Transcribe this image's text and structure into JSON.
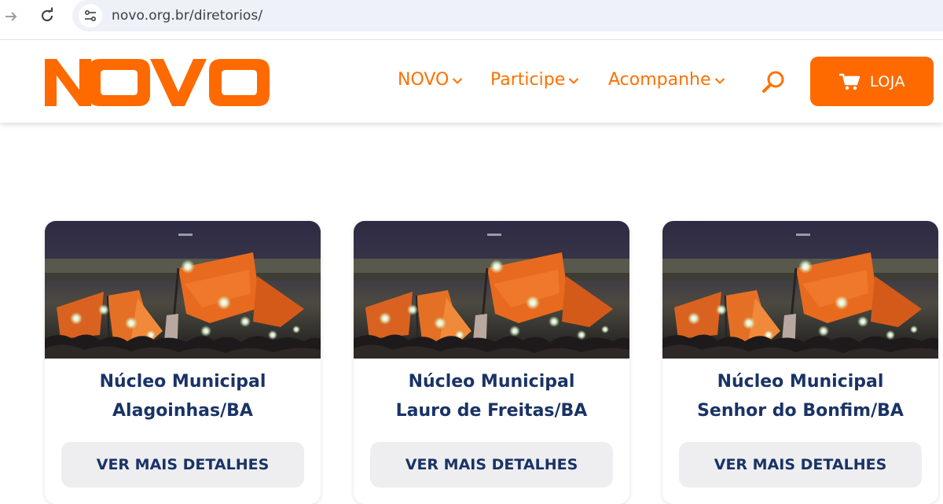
{
  "browser": {
    "url": "novo.org.br/diretorios/"
  },
  "header": {
    "logo_text": "NOVO",
    "nav": [
      {
        "label": "NOVO"
      },
      {
        "label": "Participe"
      },
      {
        "label": "Acompanhe"
      }
    ],
    "shop_label": "LOJA"
  },
  "colors": {
    "brand_orange": "#fe6a00",
    "title_navy": "#1a3366",
    "button_gray": "#eeeef0"
  },
  "cards": [
    {
      "title_line1": "Núcleo Municipal",
      "title_line2": "Alagoinhas/BA",
      "button": "VER MAIS DETALHES"
    },
    {
      "title_line1": "Núcleo Municipal",
      "title_line2": "Lauro de Freitas/BA",
      "button": "VER MAIS DETALHES"
    },
    {
      "title_line1": "Núcleo Municipal",
      "title_line2": "Senhor do Bonfim/BA",
      "button": "VER MAIS DETALHES"
    }
  ]
}
